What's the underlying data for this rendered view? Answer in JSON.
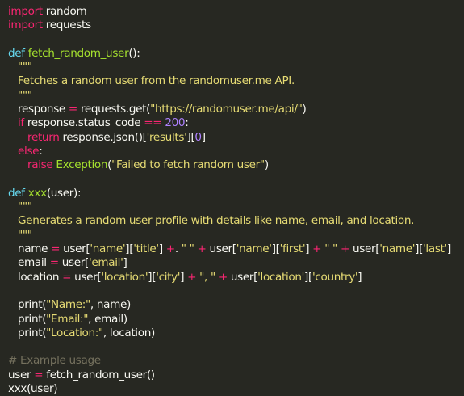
{
  "editor": {
    "lines": [
      {
        "indent": 0,
        "tokens": [
          {
            "t": "import",
            "c": "kw"
          },
          {
            "t": " random",
            "c": "pl"
          }
        ]
      },
      {
        "indent": 0,
        "tokens": [
          {
            "t": "import",
            "c": "kw"
          },
          {
            "t": " requests",
            "c": "pl"
          }
        ]
      },
      {
        "indent": 0,
        "tokens": []
      },
      {
        "indent": 0,
        "tokens": [
          {
            "t": "def",
            "c": "builtin"
          },
          {
            "t": " ",
            "c": "pl"
          },
          {
            "t": "fetch_random_user",
            "c": "fn"
          },
          {
            "t": "():",
            "c": "pl"
          }
        ]
      },
      {
        "indent": 1,
        "tokens": [
          {
            "t": "\"\"\"",
            "c": "str"
          }
        ]
      },
      {
        "indent": 1,
        "tokens": [
          {
            "t": "Fetches a random user from the randomuser.me API.",
            "c": "str"
          }
        ]
      },
      {
        "indent": 1,
        "tokens": [
          {
            "t": "\"\"\"",
            "c": "str"
          }
        ]
      },
      {
        "indent": 1,
        "tokens": [
          {
            "t": "response ",
            "c": "pl"
          },
          {
            "t": "=",
            "c": "kw"
          },
          {
            "t": " requests.get(",
            "c": "pl"
          },
          {
            "t": "\"https://randomuser.me/api/\"",
            "c": "str"
          },
          {
            "t": ")",
            "c": "pl"
          }
        ]
      },
      {
        "indent": 1,
        "tokens": [
          {
            "t": "if",
            "c": "kw"
          },
          {
            "t": " response.status_code ",
            "c": "pl"
          },
          {
            "t": "==",
            "c": "kw"
          },
          {
            "t": " ",
            "c": "pl"
          },
          {
            "t": "200",
            "c": "num"
          },
          {
            "t": ":",
            "c": "pl"
          }
        ]
      },
      {
        "indent": 2,
        "tokens": [
          {
            "t": "return",
            "c": "kw"
          },
          {
            "t": " response.json()[",
            "c": "pl"
          },
          {
            "t": "'results'",
            "c": "str"
          },
          {
            "t": "][",
            "c": "pl"
          },
          {
            "t": "0",
            "c": "num"
          },
          {
            "t": "]",
            "c": "pl"
          }
        ]
      },
      {
        "indent": 1,
        "tokens": [
          {
            "t": "else",
            "c": "kw"
          },
          {
            "t": ":",
            "c": "pl"
          }
        ]
      },
      {
        "indent": 2,
        "tokens": [
          {
            "t": "raise",
            "c": "kw"
          },
          {
            "t": " ",
            "c": "pl"
          },
          {
            "t": "Exception",
            "c": "fn"
          },
          {
            "t": "(",
            "c": "pl"
          },
          {
            "t": "\"Failed to fetch random user\"",
            "c": "str"
          },
          {
            "t": ")",
            "c": "pl"
          }
        ]
      },
      {
        "indent": 0,
        "tokens": []
      },
      {
        "indent": 0,
        "tokens": [
          {
            "t": "def",
            "c": "builtin"
          },
          {
            "t": " ",
            "c": "pl"
          },
          {
            "t": "xxx",
            "c": "fn"
          },
          {
            "t": "(user):",
            "c": "pl"
          }
        ]
      },
      {
        "indent": 1,
        "tokens": [
          {
            "t": "\"\"\"",
            "c": "str"
          }
        ]
      },
      {
        "indent": 1,
        "tokens": [
          {
            "t": "Generates a random user profile with details like name, email, and location.",
            "c": "str"
          }
        ]
      },
      {
        "indent": 1,
        "tokens": [
          {
            "t": "\"\"\"",
            "c": "str"
          }
        ]
      },
      {
        "indent": 1,
        "tokens": [
          {
            "t": "name ",
            "c": "pl"
          },
          {
            "t": "=",
            "c": "kw"
          },
          {
            "t": " user[",
            "c": "pl"
          },
          {
            "t": "'name'",
            "c": "str"
          },
          {
            "t": "][",
            "c": "pl"
          },
          {
            "t": "'title'",
            "c": "str"
          },
          {
            "t": "] ",
            "c": "pl"
          },
          {
            "t": "+",
            "c": "kw"
          },
          {
            "t": ". ",
            "c": "pl"
          },
          {
            "t": "\" \"",
            "c": "str"
          },
          {
            "t": " ",
            "c": "pl"
          },
          {
            "t": "+",
            "c": "kw"
          },
          {
            "t": " user[",
            "c": "pl"
          },
          {
            "t": "'name'",
            "c": "str"
          },
          {
            "t": "][",
            "c": "pl"
          },
          {
            "t": "'first'",
            "c": "str"
          },
          {
            "t": "] ",
            "c": "pl"
          },
          {
            "t": "+",
            "c": "kw"
          },
          {
            "t": " ",
            "c": "pl"
          },
          {
            "t": "\" \"",
            "c": "str"
          },
          {
            "t": " ",
            "c": "pl"
          },
          {
            "t": "+",
            "c": "kw"
          },
          {
            "t": " user[",
            "c": "pl"
          },
          {
            "t": "'name'",
            "c": "str"
          },
          {
            "t": "][",
            "c": "pl"
          },
          {
            "t": "'last'",
            "c": "str"
          },
          {
            "t": "]",
            "c": "pl"
          }
        ]
      },
      {
        "indent": 1,
        "tokens": [
          {
            "t": "email ",
            "c": "pl"
          },
          {
            "t": "=",
            "c": "kw"
          },
          {
            "t": " user[",
            "c": "pl"
          },
          {
            "t": "'email'",
            "c": "str"
          },
          {
            "t": "]",
            "c": "pl"
          }
        ]
      },
      {
        "indent": 1,
        "tokens": [
          {
            "t": "location ",
            "c": "pl"
          },
          {
            "t": "=",
            "c": "kw"
          },
          {
            "t": " user[",
            "c": "pl"
          },
          {
            "t": "'location'",
            "c": "str"
          },
          {
            "t": "][",
            "c": "pl"
          },
          {
            "t": "'city'",
            "c": "str"
          },
          {
            "t": "] ",
            "c": "pl"
          },
          {
            "t": "+",
            "c": "kw"
          },
          {
            "t": " ",
            "c": "pl"
          },
          {
            "t": "\", \"",
            "c": "str"
          },
          {
            "t": " ",
            "c": "pl"
          },
          {
            "t": "+",
            "c": "kw"
          },
          {
            "t": " user[",
            "c": "pl"
          },
          {
            "t": "'location'",
            "c": "str"
          },
          {
            "t": "][",
            "c": "pl"
          },
          {
            "t": "'country'",
            "c": "str"
          },
          {
            "t": "]",
            "c": "pl"
          }
        ]
      },
      {
        "indent": 0,
        "tokens": []
      },
      {
        "indent": 1,
        "tokens": [
          {
            "t": "print(",
            "c": "pl"
          },
          {
            "t": "\"Name:\"",
            "c": "str"
          },
          {
            "t": ", name)",
            "c": "pl"
          }
        ]
      },
      {
        "indent": 1,
        "tokens": [
          {
            "t": "print(",
            "c": "pl"
          },
          {
            "t": "\"Email:\"",
            "c": "str"
          },
          {
            "t": ", email)",
            "c": "pl"
          }
        ]
      },
      {
        "indent": 1,
        "tokens": [
          {
            "t": "print(",
            "c": "pl"
          },
          {
            "t": "\"Location:\"",
            "c": "str"
          },
          {
            "t": ", location)",
            "c": "pl"
          }
        ]
      },
      {
        "indent": 0,
        "tokens": []
      },
      {
        "indent": 0,
        "tokens": [
          {
            "t": "# Example usage",
            "c": "cm"
          }
        ]
      },
      {
        "indent": 0,
        "tokens": [
          {
            "t": "user ",
            "c": "pl"
          },
          {
            "t": "=",
            "c": "kw"
          },
          {
            "t": " fetch_random_user()",
            "c": "pl"
          }
        ]
      },
      {
        "indent": 0,
        "tokens": [
          {
            "t": "xxx(user)",
            "c": "pl"
          }
        ]
      }
    ]
  }
}
